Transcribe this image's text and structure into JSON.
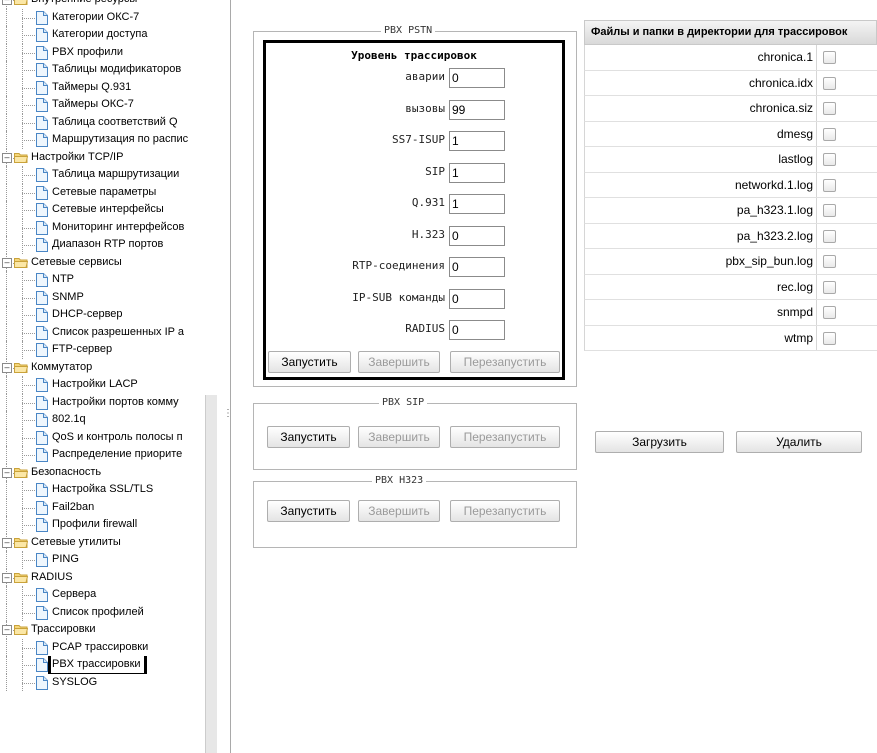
{
  "sidebar": {
    "items": [
      {
        "label": "Внутренние ресурсы",
        "type": "folder",
        "depth": 0,
        "expanded": true
      },
      {
        "label": "Категории ОКС-7",
        "type": "doc",
        "depth": 1
      },
      {
        "label": "Категории доступа",
        "type": "doc",
        "depth": 1
      },
      {
        "label": "PBX профили",
        "type": "doc",
        "depth": 1
      },
      {
        "label": "Таблицы модификаторов",
        "type": "doc",
        "depth": 1
      },
      {
        "label": "Таймеры Q.931",
        "type": "doc",
        "depth": 1
      },
      {
        "label": "Таймеры ОКС-7",
        "type": "doc",
        "depth": 1
      },
      {
        "label": "Таблица соответствий Q",
        "type": "doc",
        "depth": 1
      },
      {
        "label": "Маршрутизация по распис",
        "type": "doc",
        "depth": 1
      },
      {
        "label": "Настройки TCP/IP",
        "type": "folder",
        "depth": 0,
        "expanded": true
      },
      {
        "label": "Таблица маршрутизации",
        "type": "doc",
        "depth": 1
      },
      {
        "label": "Сетевые параметры",
        "type": "doc",
        "depth": 1
      },
      {
        "label": "Сетевые интерфейсы",
        "type": "doc",
        "depth": 1
      },
      {
        "label": "Мониторинг интерфейсов",
        "type": "doc",
        "depth": 1
      },
      {
        "label": "Диапазон RTP портов",
        "type": "doc",
        "depth": 1
      },
      {
        "label": "Сетевые сервисы",
        "type": "folder",
        "depth": 0,
        "expanded": true
      },
      {
        "label": "NTP",
        "type": "doc",
        "depth": 1
      },
      {
        "label": "SNMP",
        "type": "doc",
        "depth": 1
      },
      {
        "label": "DHCP-сервер",
        "type": "doc",
        "depth": 1
      },
      {
        "label": "Список разрешенных IP а",
        "type": "doc",
        "depth": 1
      },
      {
        "label": "FTP-сервер",
        "type": "doc",
        "depth": 1
      },
      {
        "label": "Коммутатор",
        "type": "folder",
        "depth": 0,
        "expanded": true
      },
      {
        "label": "Настройки LACP",
        "type": "doc",
        "depth": 1
      },
      {
        "label": "Настройки портов комму",
        "type": "doc",
        "depth": 1
      },
      {
        "label": "802.1q",
        "type": "doc",
        "depth": 1
      },
      {
        "label": "QoS и контроль полосы п",
        "type": "doc",
        "depth": 1
      },
      {
        "label": "Распределение приорите",
        "type": "doc",
        "depth": 1
      },
      {
        "label": "Безопасность",
        "type": "folder",
        "depth": 0,
        "expanded": true
      },
      {
        "label": "Настройка SSL/TLS",
        "type": "doc",
        "depth": 1
      },
      {
        "label": "Fail2ban",
        "type": "doc",
        "depth": 1
      },
      {
        "label": "Профили firewall",
        "type": "doc",
        "depth": 1
      },
      {
        "label": "Сетевые утилиты",
        "type": "folder",
        "depth": 0,
        "expanded": true
      },
      {
        "label": "PING",
        "type": "doc",
        "depth": 1
      },
      {
        "label": "RADIUS",
        "type": "folder",
        "depth": 0,
        "expanded": true
      },
      {
        "label": "Сервера",
        "type": "doc",
        "depth": 1
      },
      {
        "label": "Список профилей",
        "type": "doc",
        "depth": 1
      },
      {
        "label": "Трассировки",
        "type": "folder",
        "depth": 0,
        "expanded": true
      },
      {
        "label": "PCAP трассировки",
        "type": "doc",
        "depth": 1
      },
      {
        "label": "PBX трассировки",
        "type": "doc",
        "depth": 1,
        "selected": true
      },
      {
        "label": "SYSLOG",
        "type": "doc",
        "depth": 1
      }
    ]
  },
  "pbx_pstn": {
    "legend": "PBX PSTN",
    "trace_title": "Уровень трассировок",
    "fields": [
      {
        "label": "аварии",
        "value": "0"
      },
      {
        "label": "вызовы",
        "value": "99"
      },
      {
        "label": "SS7-ISUP",
        "value": "1"
      },
      {
        "label": "SIP",
        "value": "1"
      },
      {
        "label": "Q.931",
        "value": "1"
      },
      {
        "label": "H.323",
        "value": "0"
      },
      {
        "label": "RTP-соединения",
        "value": "0"
      },
      {
        "label": "IP-SUB команды",
        "value": "0"
      },
      {
        "label": "RADIUS",
        "value": "0"
      }
    ],
    "start_label": "Запустить",
    "stop_label": "Завершить",
    "restart_label": "Перезапустить"
  },
  "pbx_sip": {
    "legend": "PBX SIP",
    "start_label": "Запустить",
    "stop_label": "Завершить",
    "restart_label": "Перезапустить"
  },
  "pbx_h323": {
    "legend": "PBX H323",
    "start_label": "Запустить",
    "stop_label": "Завершить",
    "restart_label": "Перезапустить"
  },
  "files": {
    "header": "Файлы и папки в директории для трассировок",
    "items": [
      "chronica.1",
      "chronica.idx",
      "chronica.siz",
      "dmesg",
      "lastlog",
      "networkd.1.log",
      "pa_h323.1.log",
      "pa_h323.2.log",
      "pbx_sip_bun.log",
      "rec.log",
      "snmpd",
      "wtmp"
    ],
    "upload_label": "Загрузить",
    "delete_label": "Удалить"
  }
}
